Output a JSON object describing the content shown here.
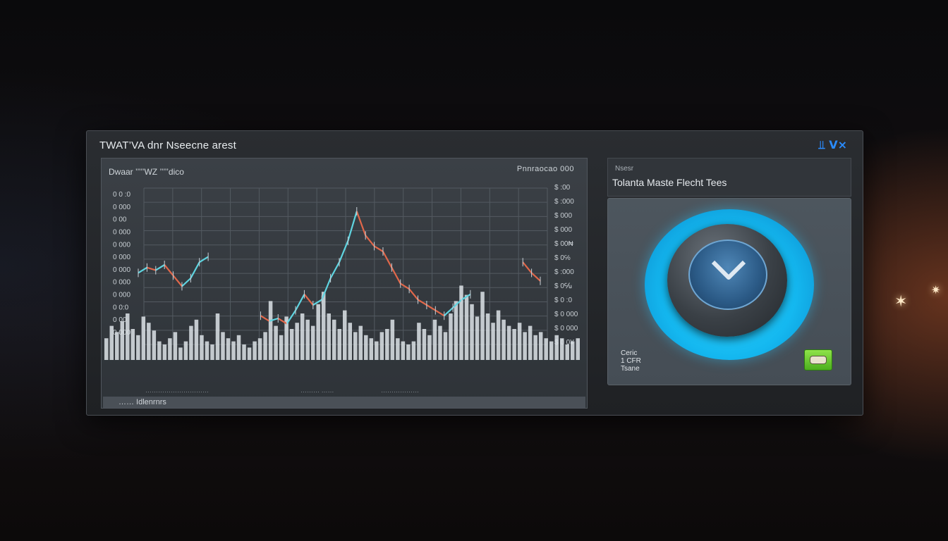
{
  "window": {
    "title": "TWAT’VA dnr Nseecne arest",
    "logo": "⫫ V⨯"
  },
  "chart": {
    "header_label": "Dwaar  ’’’’’WZ ’’’’’dico",
    "readout": "Pnnraocao 000",
    "footer_labels": [
      "…………………………",
      "……… ……",
      "………………"
    ],
    "status_text": "…… Idlenrnrs"
  },
  "chart_data": {
    "type": "line",
    "title": "",
    "left_tick_labels": [
      "0 0 :0",
      "0 000",
      "0 00",
      "0 000",
      "0 000",
      "0 000",
      "0 000",
      "0 000",
      "0 000",
      "0 0:0",
      "0 00",
      "0 000"
    ],
    "right_tick_labels": [
      "$ :00",
      "$ :000",
      "$ 000",
      "$ 000",
      "$ 00₦",
      "$ 0℅",
      "$ :000",
      "$ 0℆",
      "$ 0 :0",
      "$ 0 000",
      "$ 0 000",
      "$ 0 0¥"
    ],
    "price_series": [
      {
        "x": 0,
        "y": 22
      },
      {
        "x": 2,
        "y": 24
      },
      {
        "x": 4,
        "y": 23
      },
      {
        "x": 6,
        "y": 25
      },
      {
        "x": 8,
        "y": 21
      },
      {
        "x": 10,
        "y": 17
      },
      {
        "x": 12,
        "y": 20
      },
      {
        "x": 14,
        "y": 26
      },
      {
        "x": 16,
        "y": 28
      },
      {
        "x": 28,
        "y": 6
      },
      {
        "x": 30,
        "y": 4
      },
      {
        "x": 32,
        "y": 5
      },
      {
        "x": 34,
        "y": 3
      },
      {
        "x": 36,
        "y": 8
      },
      {
        "x": 38,
        "y": 14
      },
      {
        "x": 40,
        "y": 10
      },
      {
        "x": 42,
        "y": 12
      },
      {
        "x": 44,
        "y": 20
      },
      {
        "x": 46,
        "y": 26
      },
      {
        "x": 48,
        "y": 34
      },
      {
        "x": 50,
        "y": 45
      },
      {
        "x": 52,
        "y": 36
      },
      {
        "x": 54,
        "y": 32
      },
      {
        "x": 56,
        "y": 30
      },
      {
        "x": 58,
        "y": 24
      },
      {
        "x": 60,
        "y": 18
      },
      {
        "x": 62,
        "y": 16
      },
      {
        "x": 64,
        "y": 12
      },
      {
        "x": 66,
        "y": 10
      },
      {
        "x": 68,
        "y": 8
      },
      {
        "x": 70,
        "y": 6
      },
      {
        "x": 72,
        "y": 9
      },
      {
        "x": 74,
        "y": 12
      },
      {
        "x": 76,
        "y": 14
      },
      {
        "x": 88,
        "y": 26
      },
      {
        "x": 90,
        "y": 22
      },
      {
        "x": 92,
        "y": 19
      }
    ],
    "volume": [
      14,
      22,
      18,
      25,
      30,
      20,
      16,
      28,
      24,
      19,
      12,
      10,
      14,
      18,
      8,
      12,
      22,
      26,
      16,
      12,
      10,
      30,
      18,
      14,
      12,
      16,
      10,
      8,
      12,
      14,
      18,
      38,
      22,
      16,
      28,
      20,
      24,
      30,
      26,
      22,
      36,
      44,
      30,
      26,
      20,
      32,
      24,
      18,
      22,
      16,
      14,
      12,
      18,
      20,
      26,
      14,
      12,
      10,
      12,
      24,
      20,
      16,
      26,
      22,
      18,
      30,
      38,
      48,
      42,
      36,
      28,
      44,
      30,
      24,
      32,
      26,
      22,
      20,
      24,
      18,
      22,
      16,
      18,
      14,
      12,
      16,
      14,
      10,
      12,
      14
    ],
    "ylim": [
      0,
      50
    ],
    "grid": true
  },
  "side_panel": {
    "kicker": "Nsesr",
    "title": "Tolanta Maste Flecht Tees",
    "stats": [
      "Ceric",
      "1 CFR",
      "Tsane"
    ],
    "accent_color": "#1ec0f5",
    "toggle_color": "#6cd12e",
    "dial_icon": "chevron-down-icon"
  }
}
